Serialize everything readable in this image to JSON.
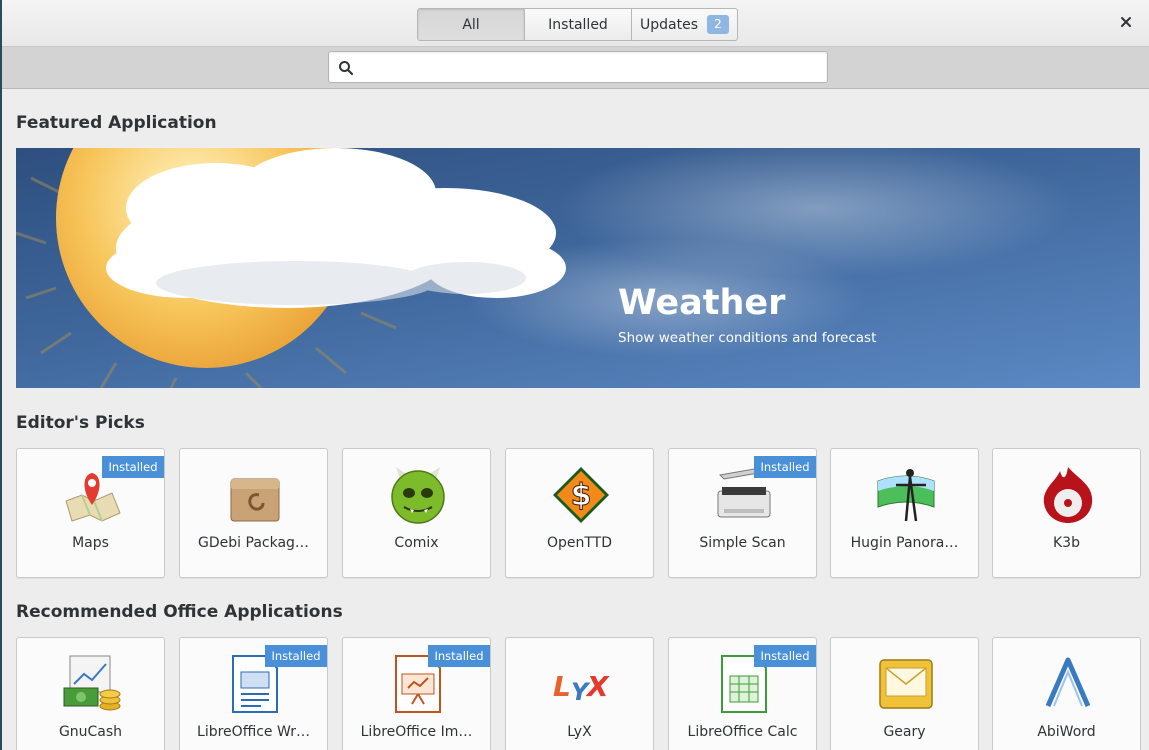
{
  "header": {
    "tabs": [
      {
        "label": "All",
        "active": true
      },
      {
        "label": "Installed",
        "active": false
      },
      {
        "label": "Updates",
        "active": false,
        "badge": "2"
      }
    ],
    "close_icon": "close-icon"
  },
  "search": {
    "placeholder": "",
    "value": "",
    "icon": "search-icon"
  },
  "featured": {
    "section_title": "Featured Application",
    "app_name": "Weather",
    "description": "Show weather conditions and forecast"
  },
  "editors_picks": {
    "section_title": "Editor's Picks",
    "apps": [
      {
        "name": "Maps",
        "installed": true,
        "installed_label": "Installed"
      },
      {
        "name": "GDebi Packag…",
        "installed": false
      },
      {
        "name": "Comix",
        "installed": false
      },
      {
        "name": "OpenTTD",
        "installed": false
      },
      {
        "name": "Simple Scan",
        "installed": true,
        "installed_label": "Installed"
      },
      {
        "name": "Hugin Panora…",
        "installed": false
      },
      {
        "name": "K3b",
        "installed": false
      }
    ]
  },
  "office": {
    "section_title": "Recommended Office Applications",
    "apps": [
      {
        "name": "GnuCash",
        "installed": false
      },
      {
        "name": "LibreOffice Wr…",
        "installed": true,
        "installed_label": "Installed"
      },
      {
        "name": "LibreOffice Im…",
        "installed": true,
        "installed_label": "Installed"
      },
      {
        "name": "LyX",
        "installed": false
      },
      {
        "name": "LibreOffice Calc",
        "installed": true,
        "installed_label": "Installed"
      },
      {
        "name": "Geary",
        "installed": false
      },
      {
        "name": "AbiWord",
        "installed": false
      }
    ]
  },
  "colors": {
    "accent": "#4a90d9",
    "badge": "#8fb7e2",
    "banner": "#3f679c"
  }
}
